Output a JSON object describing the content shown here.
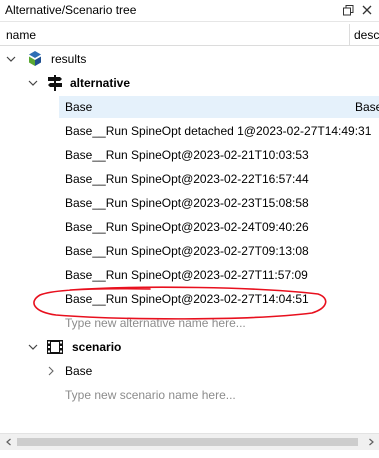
{
  "window": {
    "title": "Alternative/Scenario tree"
  },
  "header": {
    "col_name": "name",
    "col_desc": "desc"
  },
  "tree": {
    "root_label": "results",
    "alternative_label": "alternative",
    "alternatives": [
      {
        "name": "Base",
        "description": "Base"
      },
      {
        "name": "Base__Run SpineOpt detached 1@2023-02-27T14:49:31"
      },
      {
        "name": "Base__Run SpineOpt@2023-02-21T10:03:53"
      },
      {
        "name": "Base__Run SpineOpt@2023-02-22T16:57:44"
      },
      {
        "name": "Base__Run SpineOpt@2023-02-23T15:08:58"
      },
      {
        "name": "Base__Run SpineOpt@2023-02-24T09:40:26"
      },
      {
        "name": "Base__Run SpineOpt@2023-02-27T09:13:08"
      },
      {
        "name": "Base__Run SpineOpt@2023-02-27T11:57:09"
      },
      {
        "name": "Base__Run SpineOpt@2023-02-27T14:04:51"
      }
    ],
    "alternative_placeholder": "Type new alternative name here...",
    "scenario_label": "scenario",
    "scenarios": [
      {
        "name": "Base"
      }
    ],
    "scenario_placeholder": "Type new scenario name here..."
  },
  "colors": {
    "selection": "#e5f1fb",
    "annotation": "#e8101e",
    "placeholder": "#8c8c8c",
    "spine_blue": "#2f6fb5",
    "spine_green": "#5aa832"
  },
  "icons": {
    "float": "float-window-icon",
    "close": "close-icon",
    "database": "spine-database-icon",
    "alternative": "signpost-icon",
    "scenario": "film-icon"
  }
}
